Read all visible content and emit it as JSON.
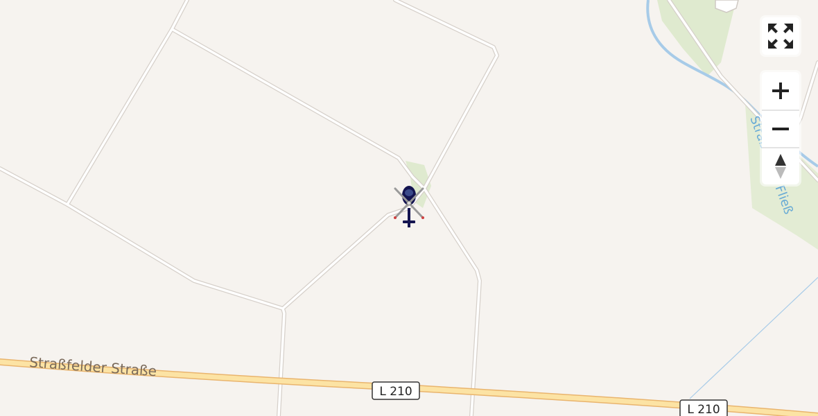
{
  "map": {
    "road_name": "Straßfelder Straße",
    "route_number": "L 210",
    "water_name": "Straßfelder Fließ",
    "colors": {
      "land": "#f6f3ef",
      "park": "#dfeacf",
      "track": "#ffffff",
      "track_edge": "#d9d4cf",
      "main_road": "#fce3a4",
      "main_road_edge": "#e9b46d",
      "water": "#a7cbe8"
    }
  },
  "marker": {
    "icon": "helicopter-icon",
    "color": "#141450"
  },
  "controls": {
    "fullscreen_icon": "fullscreen-icon",
    "zoom_in_icon": "plus-icon",
    "zoom_out_icon": "minus-icon",
    "compass_icon": "compass-icon"
  }
}
